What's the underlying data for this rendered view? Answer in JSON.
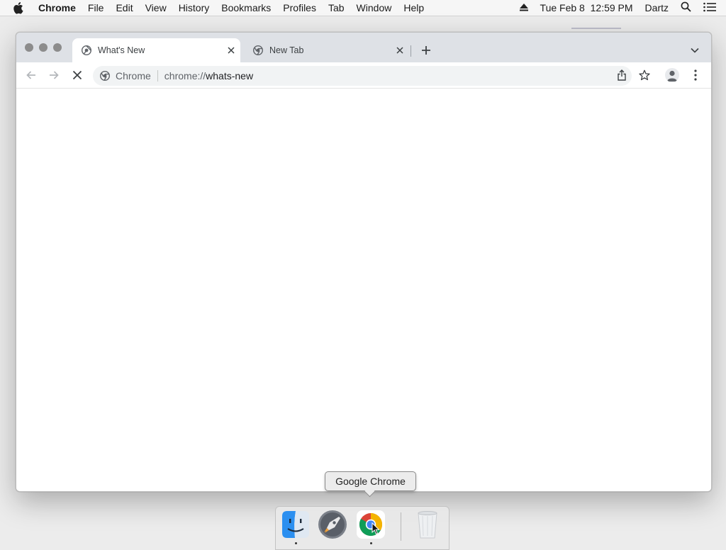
{
  "menubar": {
    "app_name": "Chrome",
    "menus": [
      "File",
      "Edit",
      "View",
      "History",
      "Bookmarks",
      "Profiles",
      "Tab",
      "Window",
      "Help"
    ],
    "datetime": "Tue Feb 8  12:59 PM",
    "user": "Dartz"
  },
  "browser": {
    "tabs": [
      {
        "title": "What's New",
        "active": true
      },
      {
        "title": "New Tab",
        "active": false
      }
    ],
    "omnibox": {
      "chip_label": "Chrome",
      "url_scheme": "chrome://",
      "url_host": "whats-new"
    }
  },
  "dock": {
    "tooltip": "Google Chrome",
    "items": [
      "finder-icon",
      "launchpad-icon",
      "chrome-icon",
      "trash-icon"
    ]
  },
  "colors": {
    "tabstrip": "#dee1e6",
    "omnibox": "#f1f3f4",
    "menubar": "#f6f6f6"
  }
}
